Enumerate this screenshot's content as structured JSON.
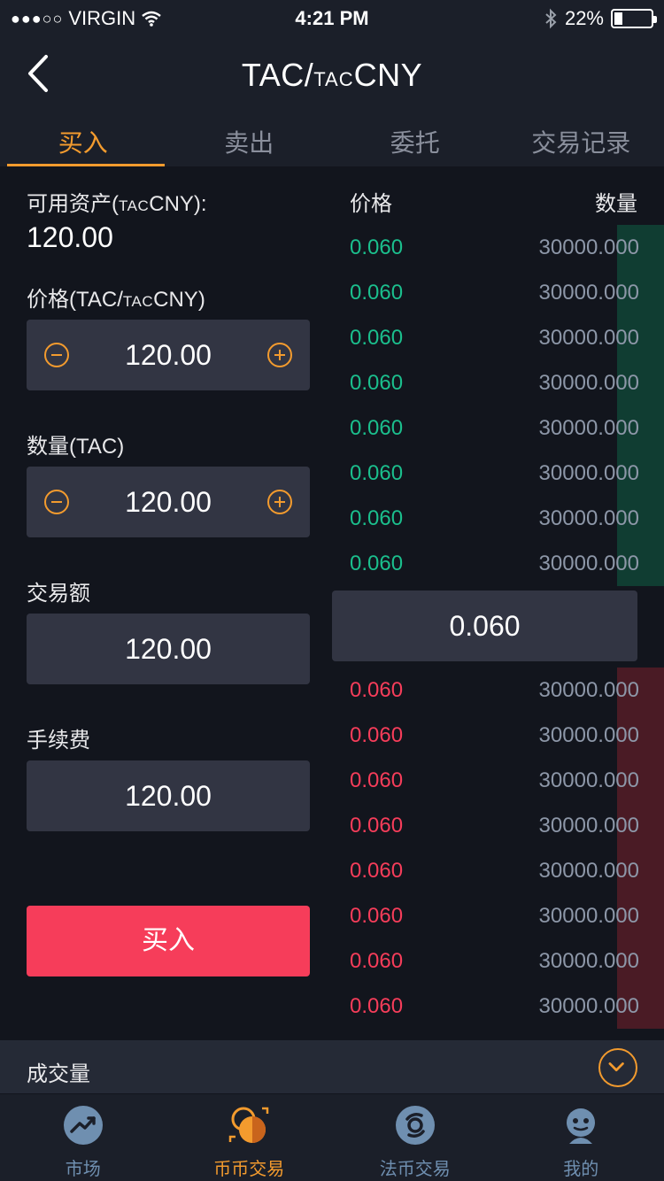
{
  "status_bar": {
    "carrier": "VIRGIN",
    "time": "4:21 PM",
    "battery": "22%"
  },
  "header": {
    "title_main": "TAC/",
    "title_small": "TAC",
    "title_tail": "CNY"
  },
  "tabs": [
    {
      "label": "买入",
      "active": true
    },
    {
      "label": "卖出"
    },
    {
      "label": "委托"
    },
    {
      "label": "交易记录"
    }
  ],
  "form": {
    "asset_label_prefix": "可用资产(",
    "asset_label_small": "TAC",
    "asset_label_suffix": "CNY):",
    "asset_value": "120.00",
    "price_label_prefix": "价格(TAC/",
    "price_label_small": "TAC",
    "price_label_suffix": "CNY)",
    "price_value": "120.00",
    "qty_label": "数量(TAC)",
    "qty_value": "120.00",
    "amount_label": "交易额",
    "amount_value": "120.00",
    "fee_label": "手续费",
    "fee_value": "120.00",
    "buy_button": "买入"
  },
  "order_book": {
    "price_header": "价格",
    "qty_header": "数量",
    "bids": [
      {
        "price": "0.060",
        "qty": "30000.000"
      },
      {
        "price": "0.060",
        "qty": "30000.000"
      },
      {
        "price": "0.060",
        "qty": "30000.000"
      },
      {
        "price": "0.060",
        "qty": "30000.000"
      },
      {
        "price": "0.060",
        "qty": "30000.000"
      },
      {
        "price": "0.060",
        "qty": "30000.000"
      },
      {
        "price": "0.060",
        "qty": "30000.000"
      },
      {
        "price": "0.060",
        "qty": "30000.000"
      }
    ],
    "mid_price": "0.060",
    "asks": [
      {
        "price": "0.060",
        "qty": "30000.000"
      },
      {
        "price": "0.060",
        "qty": "30000.000"
      },
      {
        "price": "0.060",
        "qty": "30000.000"
      },
      {
        "price": "0.060",
        "qty": "30000.000"
      },
      {
        "price": "0.060",
        "qty": "30000.000"
      },
      {
        "price": "0.060",
        "qty": "30000.000"
      },
      {
        "price": "0.060",
        "qty": "30000.000"
      },
      {
        "price": "0.060",
        "qty": "30000.000"
      }
    ]
  },
  "volume": {
    "label": "成交量"
  },
  "nav": [
    {
      "label": "市场",
      "icon": "market-icon"
    },
    {
      "label": "币币交易",
      "icon": "coin-trade-icon",
      "active": true
    },
    {
      "label": "法币交易",
      "icon": "fiat-trade-icon"
    },
    {
      "label": "我的",
      "icon": "profile-icon"
    }
  ],
  "colors": {
    "accent": "#f39b2e",
    "buy_green": "#1bbf8d",
    "sell_red": "#f63d5a",
    "background": "#12151d",
    "panel": "#323543"
  }
}
